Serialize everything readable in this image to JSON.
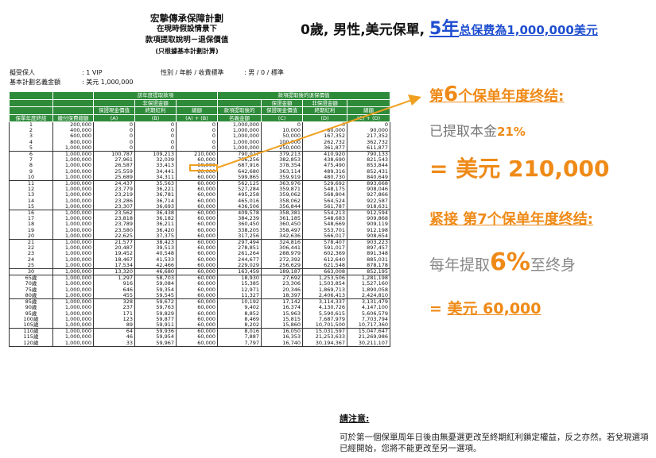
{
  "doc_header": {
    "title": "宏摯傳承保障計劃",
    "line2": "在現時假設情景下",
    "line3": "款項提取說明－退保價值",
    "line4": "(只根據基本計劃計算)"
  },
  "summary": {
    "prefix": "0歲, 男性,美元保單, ",
    "years": "5年",
    "premium": "总保费為1,000,000美元"
  },
  "meta": {
    "insured_label": "擬受保人",
    "insured_value": ": 1 VIP",
    "profile_label": "性別 / 年齡 / 收費標準",
    "profile_value": ": 男 / 0 / 標準",
    "sum_label": "基本計劃名義金額",
    "sum_value": ": 美元 1,000,000"
  },
  "table": {
    "group_withdraw": "該年度提取款項",
    "group_after": "款項提取後的退保價值",
    "sub_nonguaranteed": "非保證金額",
    "h_year": "保單年度終結",
    "h_premium": "繳付保費總額",
    "h_gcv": "保證現金價值",
    "h_a": "(A)",
    "h_terminal": "終期紅利",
    "h_b": "(B)",
    "h_total": "總額",
    "h_ab": "(A) + (B)",
    "h_notional": "款項提取後的",
    "h_notional2": "名義金額",
    "h_gcv2": "保證現金價值",
    "h_c": "(C)",
    "h_terminal2": "終期紅利",
    "h_d": "(D)",
    "h_total2": "總額",
    "h_cd": "(C) + (D)",
    "rows": [
      [
        "1",
        "200,000",
        "0",
        "0",
        "0",
        "1,000,000",
        "0",
        "0",
        "0"
      ],
      [
        "2",
        "400,000",
        "0",
        "0",
        "0",
        "1,000,000",
        "10,000",
        "80,000",
        "90,000"
      ],
      [
        "3",
        "600,000",
        "0",
        "0",
        "0",
        "1,000,000",
        "50,000",
        "167,352",
        "217,352"
      ],
      [
        "4",
        "800,000",
        "0",
        "0",
        "0",
        "1,000,000",
        "100,000",
        "262,732",
        "362,732"
      ],
      [
        "5",
        "1,000,000",
        "0",
        "0",
        "0",
        "1,000,000",
        "250,000",
        "361,877",
        "611,877"
      ],
      [
        "6",
        "1,000,000",
        "100,787",
        "109,213",
        "210,000",
        "790,027",
        "379,213",
        "410,920",
        "790,133"
      ],
      [
        "7",
        "1,000,000",
        "27,961",
        "32,039",
        "60,000",
        "736,256",
        "382,853",
        "438,690",
        "821,543"
      ],
      [
        "8",
        "1,000,000",
        "26,587",
        "33,413",
        "60,000",
        "687,916",
        "378,354",
        "475,490",
        "853,844"
      ],
      [
        "9",
        "1,000,000",
        "25,559",
        "34,441",
        "60,000",
        "642,680",
        "363,114",
        "489,316",
        "852,431"
      ],
      [
        "10",
        "1,000,000",
        "25,689",
        "34,311",
        "60,000",
        "599,865",
        "359,919",
        "480,730",
        "840,649"
      ],
      [
        "11",
        "1,000,000",
        "24,437",
        "35,563",
        "60,000",
        "562,125",
        "363,976",
        "529,692",
        "893,668"
      ],
      [
        "12",
        "1,000,000",
        "23,779",
        "36,221",
        "60,000",
        "527,284",
        "359,871",
        "548,175",
        "908,046"
      ],
      [
        "13",
        "1,000,000",
        "23,219",
        "36,781",
        "60,000",
        "495,258",
        "359,062",
        "568,804",
        "927,866"
      ],
      [
        "14",
        "1,000,000",
        "23,286",
        "36,714",
        "60,000",
        "465,016",
        "358,062",
        "564,524",
        "922,587"
      ],
      [
        "15",
        "1,000,000",
        "23,307",
        "36,693",
        "60,000",
        "436,506",
        "356,844",
        "561,787",
        "918,631"
      ],
      [
        "16",
        "1,000,000",
        "23,562",
        "36,438",
        "60,000",
        "409,578",
        "358,381",
        "554,213",
        "912,594"
      ],
      [
        "17",
        "1,000,000",
        "23,818",
        "36,182",
        "60,000",
        "384,239",
        "361,185",
        "548,683",
        "909,868"
      ],
      [
        "18",
        "1,000,000",
        "23,789",
        "36,211",
        "60,000",
        "360,450",
        "360,450",
        "548,669",
        "909,119"
      ],
      [
        "19",
        "1,000,000",
        "23,580",
        "36,420",
        "60,000",
        "338,205",
        "358,497",
        "553,701",
        "912,198"
      ],
      [
        "20",
        "1,000,000",
        "22,625",
        "37,375",
        "60,000",
        "317,256",
        "342,636",
        "566,017",
        "908,654"
      ],
      [
        "21",
        "1,000,000",
        "21,577",
        "38,423",
        "60,000",
        "297,494",
        "324,816",
        "578,407",
        "903,223"
      ],
      [
        "22",
        "1,000,000",
        "20,487",
        "39,513",
        "60,000",
        "278,851",
        "306,441",
        "591,017",
        "897,457"
      ],
      [
        "23",
        "1,000,000",
        "19,452",
        "40,548",
        "60,000",
        "261,264",
        "288,979",
        "602,369",
        "891,348"
      ],
      [
        "24",
        "1,000,000",
        "18,467",
        "41,533",
        "60,000",
        "244,677",
        "272,392",
        "612,640",
        "885,031"
      ],
      [
        "25",
        "1,000,000",
        "17,534",
        "42,466",
        "60,000",
        "229,029",
        "256,629",
        "621,548",
        "878,178"
      ],
      [
        "30",
        "1,000,000",
        "13,320",
        "46,680",
        "60,000",
        "163,459",
        "189,187",
        "663,008",
        "852,195"
      ],
      [
        "65歲",
        "1,000,000",
        "1,297",
        "58,703",
        "60,000",
        "18,930",
        "27,692",
        "1,253,506",
        "1,281,198"
      ],
      [
        "70歲",
        "1,000,000",
        "916",
        "59,084",
        "60,000",
        "15,385",
        "23,306",
        "1,503,854",
        "1,527,160"
      ],
      [
        "75歲",
        "1,000,000",
        "646",
        "59,354",
        "60,000",
        "12,971",
        "20,346",
        "1,869,713",
        "1,890,058"
      ],
      [
        "80歲",
        "1,000,000",
        "455",
        "59,545",
        "60,000",
        "11,327",
        "18,397",
        "2,406,413",
        "2,424,810"
      ],
      [
        "85歲",
        "1,000,000",
        "328",
        "59,672",
        "60,000",
        "10,192",
        "17,142",
        "3,114,337",
        "3,131,479"
      ],
      [
        "90歲",
        "1,000,000",
        "237",
        "59,763",
        "60,000",
        "9,402",
        "16,374",
        "4,130,726",
        "4,147,100"
      ],
      [
        "95歲",
        "1,000,000",
        "171",
        "59,829",
        "60,000",
        "8,852",
        "15,963",
        "5,590,615",
        "5,606,579"
      ],
      [
        "100歲",
        "1,000,000",
        "123",
        "59,877",
        "60,000",
        "8,469",
        "15,815",
        "7,687,979",
        "7,703,794"
      ],
      [
        "105歲",
        "1,000,000",
        "89",
        "59,911",
        "60,000",
        "8,202",
        "15,860",
        "10,701,500",
        "10,717,360"
      ],
      [
        "110歲",
        "1,000,000",
        "64",
        "59,936",
        "60,000",
        "8,016",
        "16,050",
        "15,031,597",
        "15,047,647"
      ],
      [
        "115歲",
        "1,000,000",
        "46",
        "59,954",
        "60,000",
        "7,887",
        "16,353",
        "21,253,633",
        "21,269,986"
      ],
      [
        "120歲",
        "1,000,000",
        "33",
        "59,967",
        "60,000",
        "7,797",
        "16,740",
        "30,194,367",
        "30,211,107"
      ]
    ]
  },
  "callout": {
    "h1_a": "第",
    "h1_num": "6",
    "h1_b": "个保单年度终结:",
    "line2_a": "已提取本金",
    "line2_pct": "21%",
    "amount1": "= 美元 210,000",
    "h2": "紧接 第7个保单年度终结:",
    "line4_a": "每年提取",
    "line4_pct": "6%",
    "line4_b": "至终身",
    "amount2_eq": "= ",
    "amount2": "美元 60,000"
  },
  "note": {
    "title": "請注意:",
    "body": "可於第一個保單周年日後由無憂選更改至終期紅利鎖定權益，反之亦然。若兌現選項已經開始，您將不能更改至另一選項。"
  },
  "colors": {
    "header_green": "#2e8b3a",
    "accent_orange": "#ef8a17",
    "accent_blue": "#1f4fd0"
  }
}
